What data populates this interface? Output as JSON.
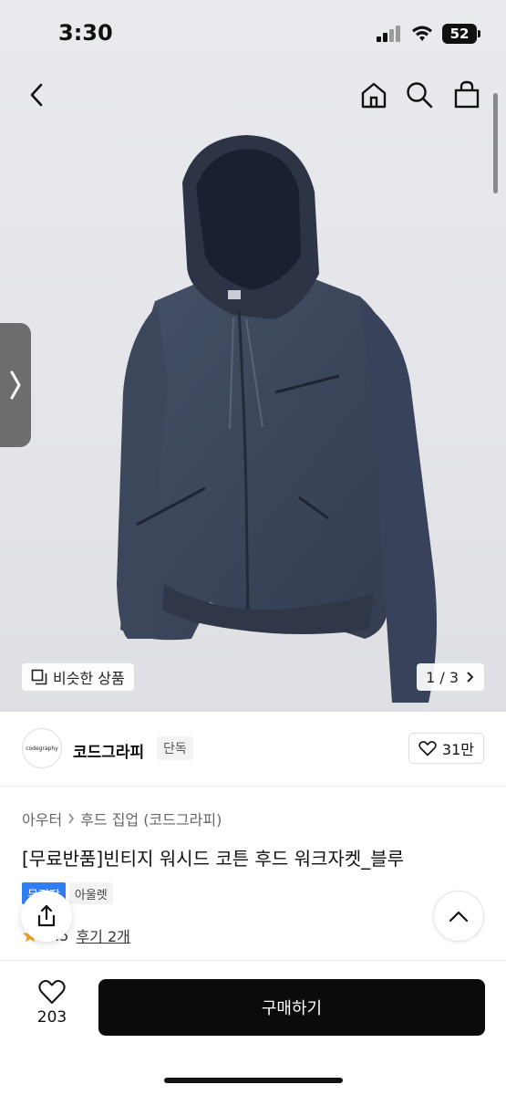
{
  "status_bar": {
    "time": "3:30",
    "battery": "52"
  },
  "nav": {
    "back_icon": "chevron-left-icon",
    "home_icon": "home-icon",
    "search_icon": "search-icon",
    "cart_icon": "shopping-bag-icon"
  },
  "hero": {
    "similar_label": "비슷한 상품",
    "page_counter": "1 / 3",
    "image_subject": "navy hooded zip-up work jacket"
  },
  "store": {
    "logo_text": "codegraphy",
    "name": "코드그라피",
    "badge": "단독",
    "likes": "31만"
  },
  "breadcrumb": {
    "level1": "아우터",
    "level2": "후드 집업 (코드그라피)"
  },
  "product": {
    "title": "[무료반품]빈티지 워시드 코튼 후드 워크자켓_블루",
    "tag_primary": "무진장",
    "tag_secondary": "아울렛",
    "rating": "4.5",
    "review_link": "후기 2개"
  },
  "bottom_bar": {
    "wish_count": "203",
    "buy_label": "구매하기"
  },
  "colors": {
    "accent_blue": "#2f7ef5",
    "buy_button": "#0b0b0b",
    "jacket_navy": "#3a4457"
  }
}
